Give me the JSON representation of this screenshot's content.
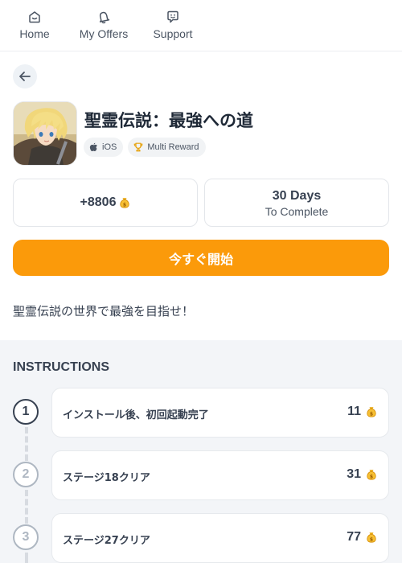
{
  "nav": {
    "items": [
      {
        "label": "Home",
        "icon": "home-icon"
      },
      {
        "label": "My Offers",
        "icon": "bell-icon"
      },
      {
        "label": "Support",
        "icon": "chat-icon"
      }
    ]
  },
  "offer": {
    "title": "聖霊伝説：最強への道",
    "tags": [
      {
        "label": "iOS",
        "icon": "apple-icon"
      },
      {
        "label": "Multi Reward",
        "icon": "trophy-icon"
      }
    ],
    "reward": "+8806",
    "reward_icon": "coin-bag-icon",
    "days": "30 Days",
    "days_sub": "To Complete",
    "start_label": "今すぐ開始",
    "description": "聖霊伝説の世界で最強を目指せ！"
  },
  "instructions": {
    "title": "INSTRUCTIONS",
    "steps": [
      {
        "num": "1",
        "text": "インストール後、初回起動完了",
        "reward": "11",
        "state": "active"
      },
      {
        "num": "2",
        "text": "ステージ18クリア",
        "reward": "31",
        "state": "pending"
      },
      {
        "num": "3",
        "text": "ステージ27クリア",
        "reward": "77",
        "state": "pending"
      }
    ]
  },
  "colors": {
    "accent": "#fb9a0a",
    "section_bg": "#f3f5f8",
    "text": "#374151"
  }
}
